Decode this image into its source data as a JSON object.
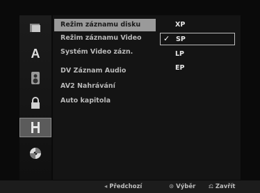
{
  "sidebar": {
    "icons": [
      "disc-icon",
      "language-icon",
      "audio-icon",
      "lock-icon",
      "film-icon",
      "disc-settings-icon"
    ],
    "active_index": 4
  },
  "menu": {
    "items": [
      {
        "label": "Režim záznamu disku"
      },
      {
        "label": "Režim záznamu Video"
      },
      {
        "label": "Systém Video zázn."
      },
      {
        "label": "DV Záznam Audio"
      },
      {
        "label": "AV2 Nahrávání"
      },
      {
        "label": "Auto kapitola"
      }
    ],
    "active_index": 0
  },
  "options": {
    "items": [
      {
        "label": "XP"
      },
      {
        "label": "SP"
      },
      {
        "label": "LP"
      },
      {
        "label": "EP"
      }
    ],
    "selected_index": 1,
    "check_mark": "✓"
  },
  "footer": {
    "prev": {
      "icon": "◂",
      "label": "Předchozí"
    },
    "select": {
      "icon": "⊙",
      "label": "Výběr"
    },
    "close": {
      "icon": "⎌",
      "label": "Zavřít"
    }
  },
  "colors": {
    "background": "#0a0a0a",
    "highlight": "#9a9a9a",
    "text": "#b9b9b9"
  }
}
